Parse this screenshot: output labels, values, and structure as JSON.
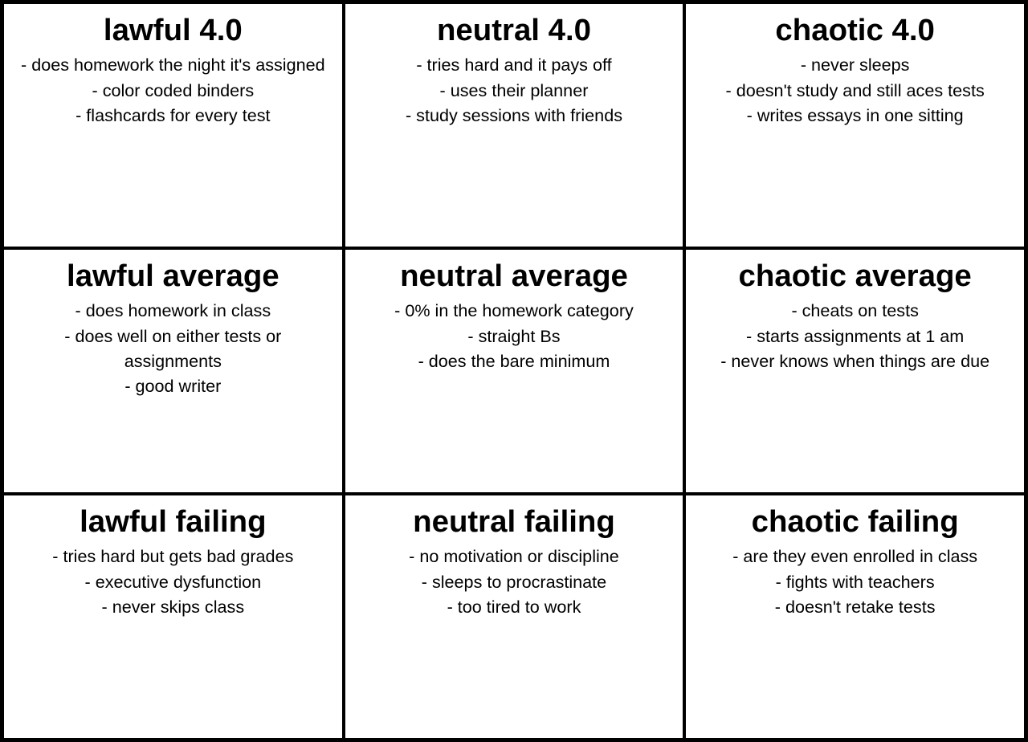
{
  "cells": [
    {
      "id": "lawful-4",
      "title": "lawful 4.0",
      "body": "- does homework the night it's assigned\n- color coded binders\n- flashcards for every test"
    },
    {
      "id": "neutral-4",
      "title": "neutral 4.0",
      "body": "- tries hard and it pays off\n- uses their planner\n- study sessions with friends"
    },
    {
      "id": "chaotic-4",
      "title": "chaotic 4.0",
      "body": "- never sleeps\n- doesn't study and still aces tests\n- writes essays in one sitting"
    },
    {
      "id": "lawful-average",
      "title": "lawful average",
      "body": "- does homework in class\n- does well on either tests or assignments\n- good writer"
    },
    {
      "id": "neutral-average",
      "title": "neutral average",
      "body": "- 0% in the homework category\n- straight Bs\n- does the bare minimum"
    },
    {
      "id": "chaotic-average",
      "title": "chaotic average",
      "body": "- cheats on tests\n- starts assignments at 1 am\n- never knows when things are due"
    },
    {
      "id": "lawful-failing",
      "title": "lawful failing",
      "body": "- tries hard but gets bad grades\n- executive dysfunction\n- never skips class"
    },
    {
      "id": "neutral-failing",
      "title": "neutral failing",
      "body": "- no motivation or discipline\n- sleeps to procrastinate\n- too tired to work"
    },
    {
      "id": "chaotic-failing",
      "title": "chaotic failing",
      "body": "- are they even enrolled in class\n- fights with teachers\n- doesn't retake tests"
    }
  ]
}
